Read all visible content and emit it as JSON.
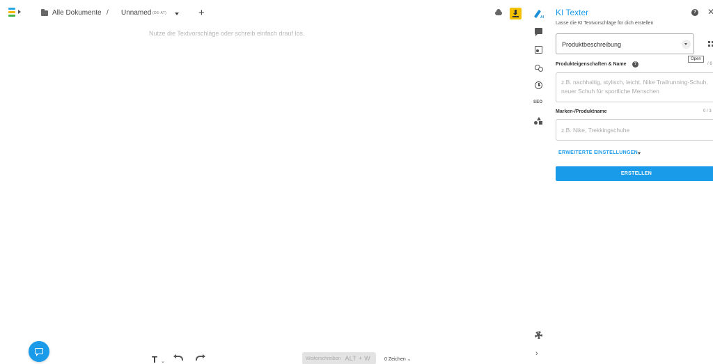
{
  "header": {
    "breadcrumb_all": "Alle Dokumente",
    "breadcrumb_sep": "/",
    "document_name": "Unnamed",
    "language_tag": "(DE-AT)",
    "add_label": "+"
  },
  "editor": {
    "placeholder": "Nutze die Textvorschläge oder schreib einfach drauf los."
  },
  "bottom_bar": {
    "text_format_label": "T",
    "continue_label": "Weiterschreiben",
    "continue_shortcut": "ALT + W",
    "char_count": "0 Zeichen ⌄"
  },
  "rail": {
    "seo_label": "SEO",
    "collapse_label": "›"
  },
  "panel": {
    "title": "KI Texter",
    "subtitle": "Lasse die KI Textvorschläge für dich erstellen",
    "select_value": "Produktbeschreibung",
    "tooltip": "Open",
    "field1_label": "Produkteigenschaften & Name",
    "field1_counter": "/ 6",
    "field1_placeholder": "z.B. nachhaltig, stylisch, leicht, Nike Trailrunning-Schuh, neuer Schuh für sportliche Menschen",
    "field2_label": "Marken-/Produktname",
    "field2_counter": "0 / 3",
    "field2_placeholder": "z.B. Nike, Trekkingschuhe",
    "advanced_label": "ERWEITERTE EINSTELLUNGEN",
    "create_label": "ERSTELLEN",
    "help_glyph": "?",
    "close_glyph": "✕"
  },
  "colors": {
    "accent": "#1a9bea",
    "download": "#f2c200"
  }
}
